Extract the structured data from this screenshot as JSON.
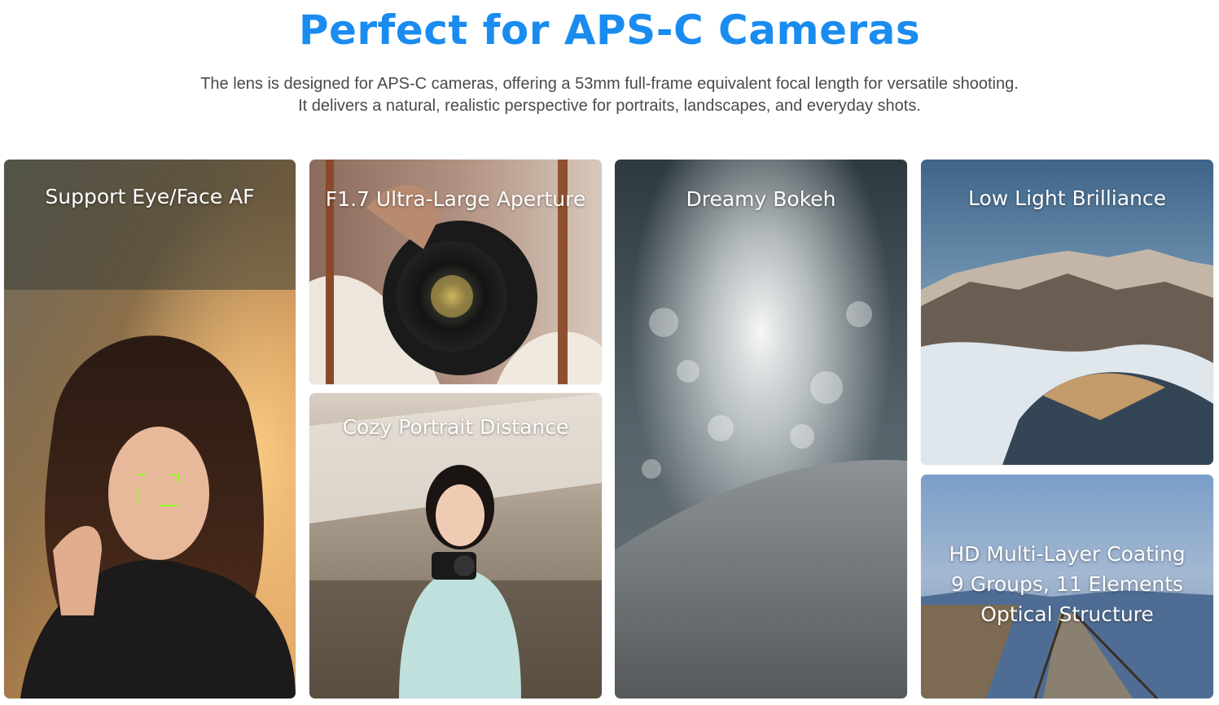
{
  "header": {
    "title": "Perfect for APS-C Cameras",
    "title_color": "#1a8cf0",
    "description_lines": [
      "The lens is designed for APS-C cameras, offering a 53mm full-frame equivalent focal length for versatile shooting.",
      "It delivers a natural, realistic perspective for portraits, landscapes, and everyday shots."
    ]
  },
  "features": {
    "eye_af": {
      "label": "Support Eye/Face AF",
      "image": "portrait-woman-leather-jacket-photo",
      "focus_box_color": "#8cff1e"
    },
    "aperture": {
      "label": "F1.7 Ultra-Large Aperture",
      "image": "hands-holding-camera-lens-photo"
    },
    "portrait": {
      "label": "Cozy Portrait Distance",
      "image": "woman-with-camera-outdoor-cafe-photo"
    },
    "bokeh": {
      "label": "Dreamy Bokeh",
      "image": "snow-surface-bokeh-photo"
    },
    "low_light": {
      "label": "Low Light Brilliance",
      "image": "snowy-mountains-dusk-photo"
    },
    "coating": {
      "label_lines": [
        "HD Multi-Layer Coating",
        "9 Groups, 11 Elements",
        "Optical Structure"
      ],
      "image": "wooden-boardwalk-snow-lake-photo"
    }
  }
}
